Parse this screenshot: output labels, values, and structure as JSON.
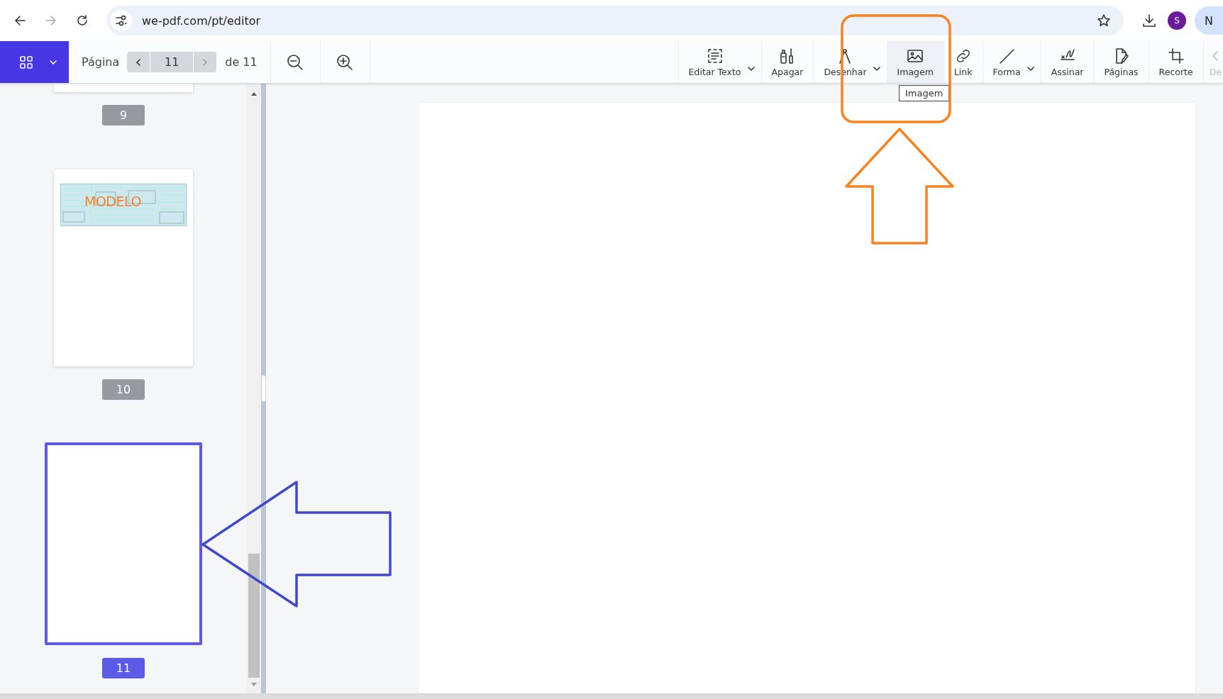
{
  "browser": {
    "url": "we-pdf.com/pt/editor",
    "profile_initial": "S",
    "account_initial": "N"
  },
  "toolbar": {
    "page_label": "Página",
    "page_value": "11",
    "page_total": "de 11",
    "tools": [
      {
        "label": "Editar Texto",
        "kind": "text",
        "dropdown": true,
        "hovered": false,
        "disabled": false
      },
      {
        "label": "Apagar",
        "kind": "erase",
        "dropdown": false,
        "hovered": false,
        "disabled": false
      },
      {
        "label": "Desenhar",
        "kind": "draw",
        "dropdown": true,
        "hovered": false,
        "disabled": false
      },
      {
        "label": "Imagem",
        "kind": "image",
        "dropdown": false,
        "hovered": true,
        "disabled": false
      },
      {
        "label": "Link",
        "kind": "link",
        "dropdown": false,
        "hovered": false,
        "disabled": false
      },
      {
        "label": "Forma",
        "kind": "shape",
        "dropdown": true,
        "hovered": false,
        "disabled": false
      },
      {
        "label": "Assinar",
        "kind": "sign",
        "dropdown": false,
        "hovered": false,
        "disabled": false
      },
      {
        "label": "Páginas",
        "kind": "pages",
        "dropdown": false,
        "hovered": false,
        "disabled": false
      },
      {
        "label": "Recorte",
        "kind": "crop",
        "dropdown": false,
        "hovered": false,
        "disabled": false
      },
      {
        "label": "De",
        "kind": "cut",
        "dropdown": false,
        "hovered": false,
        "disabled": true
      }
    ]
  },
  "tooltip": "Imagem",
  "thumbnails": [
    {
      "number": "9",
      "selected": false,
      "kind": "blank"
    },
    {
      "number": "10",
      "selected": false,
      "kind": "form",
      "stamp": "MODELO"
    },
    {
      "number": "11",
      "selected": true,
      "kind": "blank"
    }
  ],
  "annotations": [
    {
      "kind": "box-arrow-up",
      "color": "#f5811f"
    },
    {
      "kind": "arrow-left",
      "color": "#3f48cc"
    }
  ]
}
